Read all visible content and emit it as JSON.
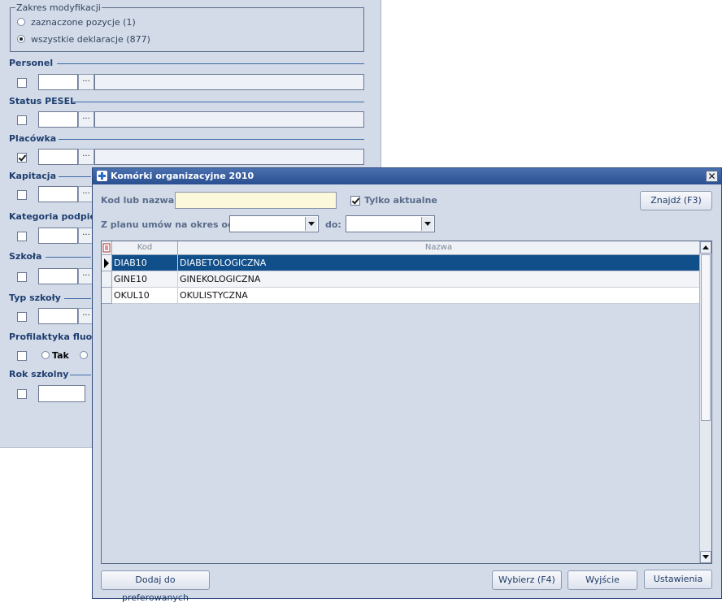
{
  "background_panel": {
    "group": {
      "title": "Zakres modyfikacji",
      "options": [
        "zaznaczone pozycje (1)",
        "wszystkie deklaracje (877)"
      ],
      "selected_index": 1
    },
    "sections": [
      {
        "label": "Personel",
        "checked": false
      },
      {
        "label": "Status PESEL",
        "checked": false
      },
      {
        "label": "Placówka",
        "checked": true
      },
      {
        "label": "Kapitacja",
        "checked": false
      },
      {
        "label": "Kategoria podpiec",
        "checked": false
      },
      {
        "label": "Szkoła",
        "checked": false
      },
      {
        "label": "Typ szkoły",
        "checked": false
      },
      {
        "label": "Profilaktyka fluorl",
        "checked": false
      },
      {
        "label": "Rok szkolny",
        "checked": false
      }
    ],
    "fluor_option_tak": "Tak",
    "ellipsis": "..."
  },
  "dialog": {
    "title": "Komórki organizacyjne 2010",
    "close": "✕",
    "code_label": "Kod lub nazwa:",
    "code_value": "",
    "only_current_label": "Tylko aktualne",
    "only_current_checked": true,
    "find_button": "Znajdź (F3)",
    "plan_label": "Z planu umów na okres od:",
    "plan_from": "",
    "plan_to_label": "do:",
    "plan_to": "",
    "grid": {
      "columns": [
        "Kod",
        "Nazwa"
      ],
      "rows": [
        {
          "kod": "DIAB10",
          "nazwa": "DIABETOLOGICZNA",
          "selected": true
        },
        {
          "kod": "GINE10",
          "nazwa": "GINEKOLOGICZNA",
          "selected": false
        },
        {
          "kod": "OKUL10",
          "nazwa": "OKULISTYCZNA",
          "selected": false
        }
      ]
    },
    "buttons": {
      "add_preferred": "Dodaj do preferowanych",
      "select": "Wybierz (F4)",
      "exit": "Wyjście",
      "settings": "Ustawienia"
    }
  }
}
